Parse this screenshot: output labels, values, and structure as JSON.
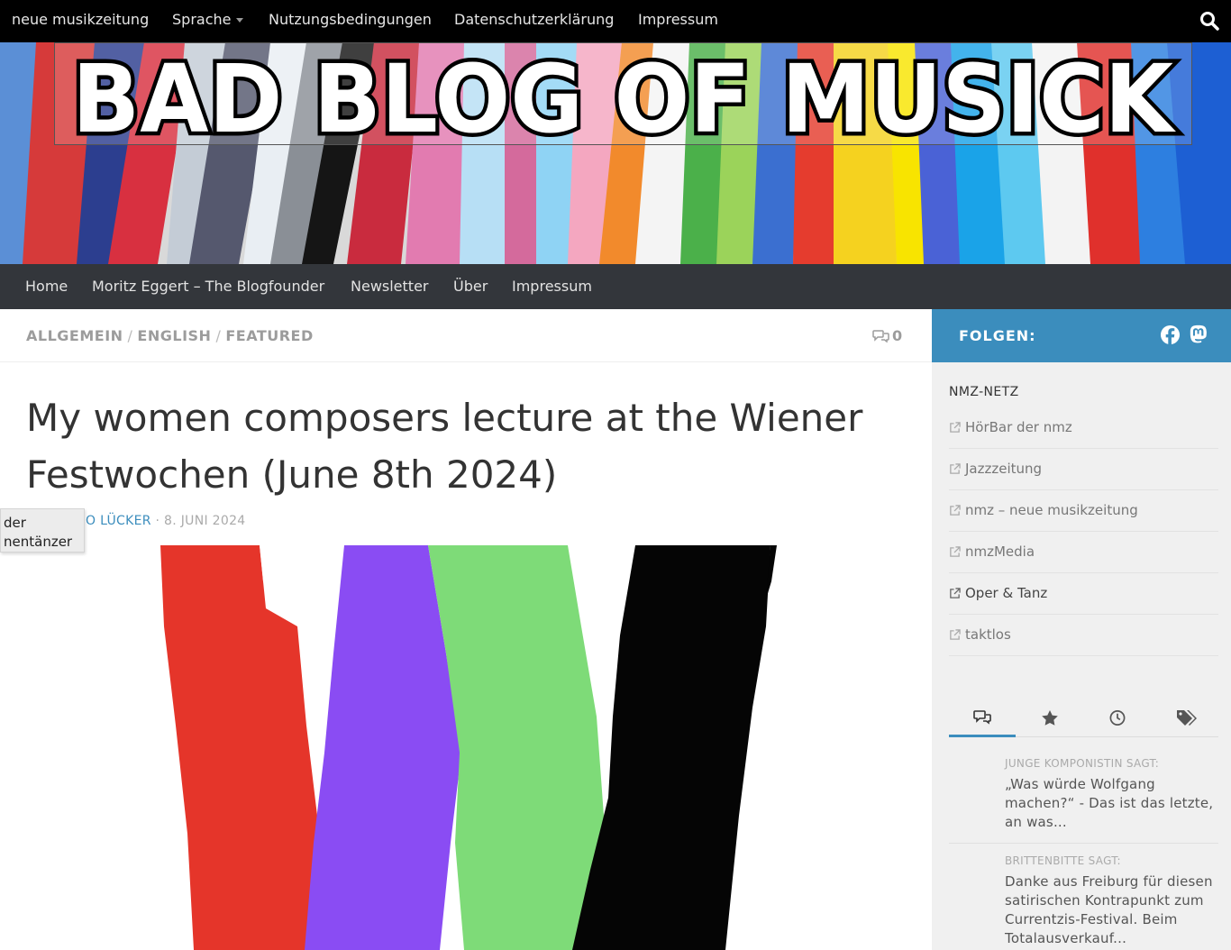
{
  "topbar": {
    "items": [
      "neue musikzeitung",
      "Sprache",
      "Nutzungsbedingungen",
      "Datenschutzerklärung",
      "Impressum"
    ]
  },
  "header": {
    "logo_text": "BAD BLOG OF MUSICK"
  },
  "nav": {
    "items": [
      "Home",
      "Moritz Eggert – The Blogfounder",
      "Newsletter",
      "Über",
      "Impressum"
    ]
  },
  "post": {
    "categories": [
      "ALLGEMEIN",
      "ENGLISH",
      "FEATURED"
    ],
    "comment_count": "0",
    "title": "My women composers lecture at the Wiener Festwochen (June 8th 2024)",
    "author": "O LÜCKER",
    "date": "8. JUNI 2024"
  },
  "tooltip": {
    "line1": "der",
    "line2": "nentänzer"
  },
  "featured_image": {
    "stroke_colors": [
      "#e5352a",
      "#8a4cf3",
      "#7edb78",
      "#050505"
    ]
  },
  "sidebar": {
    "follow_label": "FOLGEN:",
    "social_icons": [
      "facebook-icon",
      "mastodon-icon"
    ],
    "nmz_heading": "NMZ-NETZ",
    "links": [
      "HörBar der nmz",
      "Jazzzeitung",
      "nmz – neue musikzeitung",
      "nmzMedia",
      "Oper & Tanz",
      "taktlos"
    ],
    "tabs": [
      "comments-icon",
      "star-icon",
      "clock-icon",
      "tags-icon"
    ],
    "recent_comments": [
      {
        "who": "JUNGE KOMPONISTIN SAGT:",
        "text": "„Was würde Wolfgang machen?“ - Das ist das letzte, an was..."
      },
      {
        "who": "BRITTENBITTE SAGT:",
        "text": "Danke aus Freiburg für diesen satirischen Kontrapunkt zum Currentzis-Festival. Beim Totalausverkauf..."
      }
    ]
  },
  "colors": {
    "topbar": "#000000",
    "nav": "#33363b",
    "accent": "#3b8dbd",
    "sidebar": "#f0f0f0"
  }
}
